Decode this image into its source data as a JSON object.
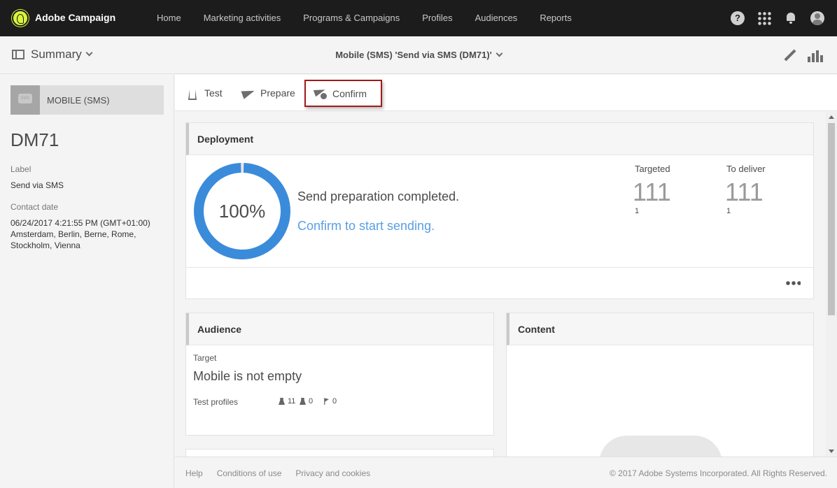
{
  "app": {
    "name": "Adobe Campaign"
  },
  "topnav": {
    "items": [
      "Home",
      "Marketing activities",
      "Programs & Campaigns",
      "Profiles",
      "Audiences",
      "Reports"
    ]
  },
  "top_icons": {
    "help": "help-icon",
    "apps": "app-grid-icon",
    "notifications": "bell-icon",
    "profile": "avatar-icon"
  },
  "header": {
    "summary_label": "Summary",
    "title": "Mobile (SMS) 'Send via SMS (DM71)'"
  },
  "sidebar": {
    "channel": "MOBILE (SMS)",
    "code": "DM71",
    "label_title": "Label",
    "label_value": "Send via SMS",
    "contact_date_title": "Contact date",
    "contact_date_value": "06/24/2017 4:21:55 PM (GMT+01:00) Amsterdam, Berlin, Berne, Rome, Stockholm, Vienna"
  },
  "toolbar": {
    "test_label": "Test",
    "prepare_label": "Prepare",
    "confirm_label": "Confirm"
  },
  "deployment": {
    "title": "Deployment",
    "progress_percent": 100,
    "progress_label": "100%",
    "status": "Send preparation completed.",
    "confirm_link": "Confirm to start sending.",
    "targeted_label": "Targeted",
    "targeted_value": "111",
    "targeted_sub": "1",
    "to_deliver_label": "To deliver",
    "to_deliver_value": "111",
    "to_deliver_sub": "1",
    "accent_color": "#3b8bdb"
  },
  "audience": {
    "title": "Audience",
    "target_label": "Target",
    "target_value": "Mobile is not empty",
    "test_profiles_label": "Test profiles",
    "stat1": "11",
    "stat2": "0",
    "stat3": "0"
  },
  "content_card": {
    "title": "Content"
  },
  "footer": {
    "links": [
      "Help",
      "Conditions of use",
      "Privacy and cookies"
    ],
    "copyright": "© 2017 Adobe Systems Incorporated. All Rights Reserved."
  }
}
